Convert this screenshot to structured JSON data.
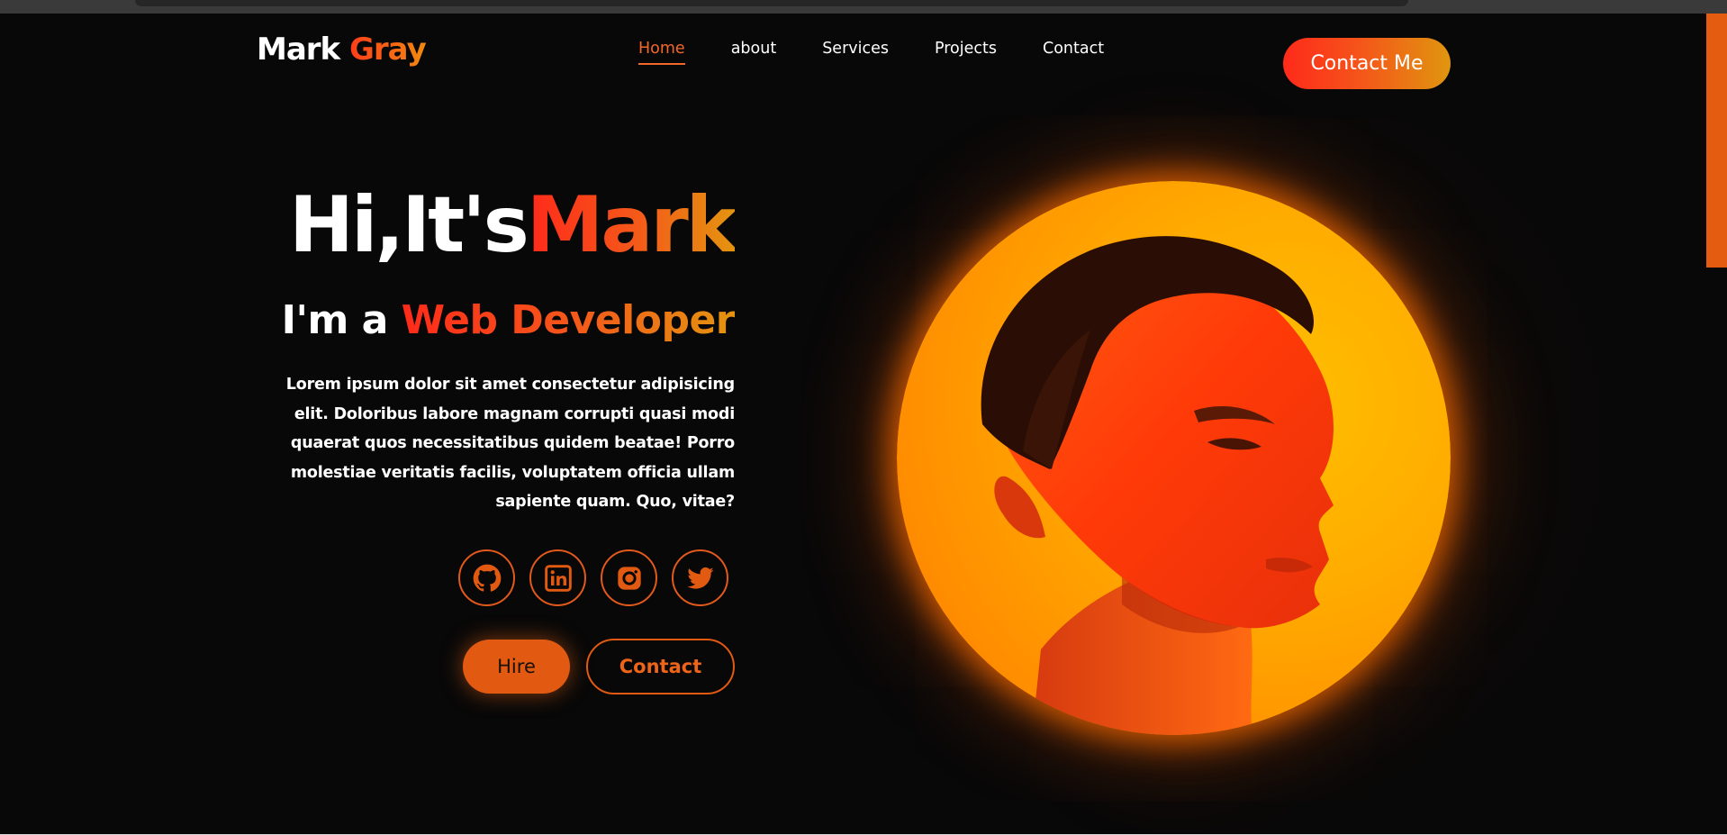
{
  "brand": {
    "first": "Mark",
    "last": "Gray"
  },
  "nav": {
    "items": [
      {
        "label": "Home",
        "active": true
      },
      {
        "label": "about"
      },
      {
        "label": "Services"
      },
      {
        "label": "Projects"
      },
      {
        "label": "Contact"
      }
    ],
    "cta_label": "Contact Me"
  },
  "hero": {
    "greeting": "Hi,It's",
    "name": "Mark",
    "role_prefix": "I'm a",
    "role": "Web Developer",
    "intro": "Lorem ipsum dolor sit amet consectetur adipisicing elit. Doloribus labore magnam corrupti quasi modi quaerat quos necessitatibus quidem beatae! Porro molestiae veritatis facilis, voluptatem officia ullam sapiente quam. Quo, vitae?",
    "socials": [
      {
        "icon": "github-icon"
      },
      {
        "icon": "linkedin-icon"
      },
      {
        "icon": "instagram-icon"
      },
      {
        "icon": "twitter-icon"
      }
    ],
    "hire_label": "Hire",
    "contact_label": "Contact",
    "portrait": "portrait-photo"
  },
  "colors": {
    "background": "#080808",
    "accent": "#e25a12",
    "gradient_start": "#ff2a1a",
    "gradient_end": "#e49410"
  }
}
